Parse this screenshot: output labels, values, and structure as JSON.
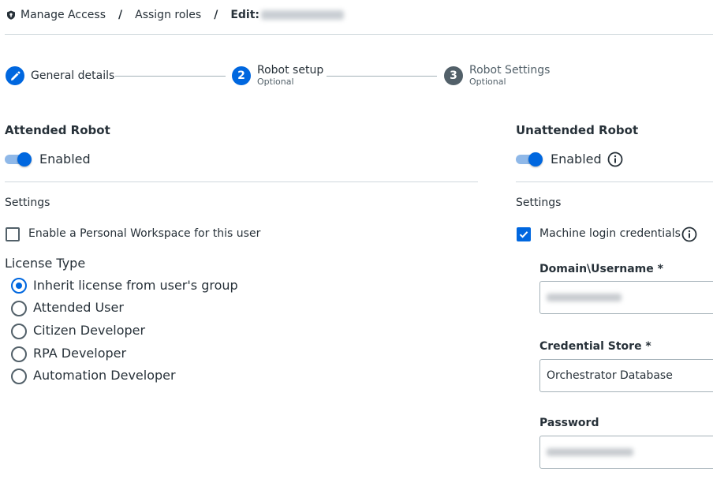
{
  "breadcrumb": {
    "items": [
      "Manage Access",
      "Assign roles"
    ],
    "separator": "/",
    "edit_label": "Edit:"
  },
  "stepper": {
    "steps": [
      {
        "number": "1",
        "label": "General details",
        "sub": "",
        "state": "completed"
      },
      {
        "number": "2",
        "label": "Robot setup",
        "sub": "Optional",
        "state": "active"
      },
      {
        "number": "3",
        "label": "Robot Settings",
        "sub": "Optional",
        "state": "upcoming"
      }
    ]
  },
  "attended": {
    "title": "Attended Robot",
    "toggle_label": "Enabled",
    "toggle_on": true,
    "settings_title": "Settings",
    "personal_workspace_label": "Enable a Personal Workspace for this user",
    "personal_workspace_checked": false,
    "license_title": "License Type",
    "license_options": [
      "Inherit license from user's group",
      "Attended User",
      "Citizen Developer",
      "RPA Developer",
      "Automation Developer"
    ],
    "license_selected_index": 0
  },
  "unattended": {
    "title": "Unattended Robot",
    "toggle_label": "Enabled",
    "toggle_on": true,
    "settings_title": "Settings",
    "machine_login_label": "Machine login credentials",
    "machine_login_checked": true,
    "domain_username_label": "Domain\\Username *",
    "credential_store_label": "Credential Store *",
    "credential_store_value": "Orchestrator Database",
    "password_label": "Password"
  },
  "colors": {
    "accent": "#0067df",
    "step_upcoming": "#526069",
    "divider": "#cfd8dd"
  },
  "icons": {
    "breadcrumb": "shield-icon",
    "step_completed": "pencil-icon",
    "info": "info-icon",
    "check": "check-icon"
  }
}
